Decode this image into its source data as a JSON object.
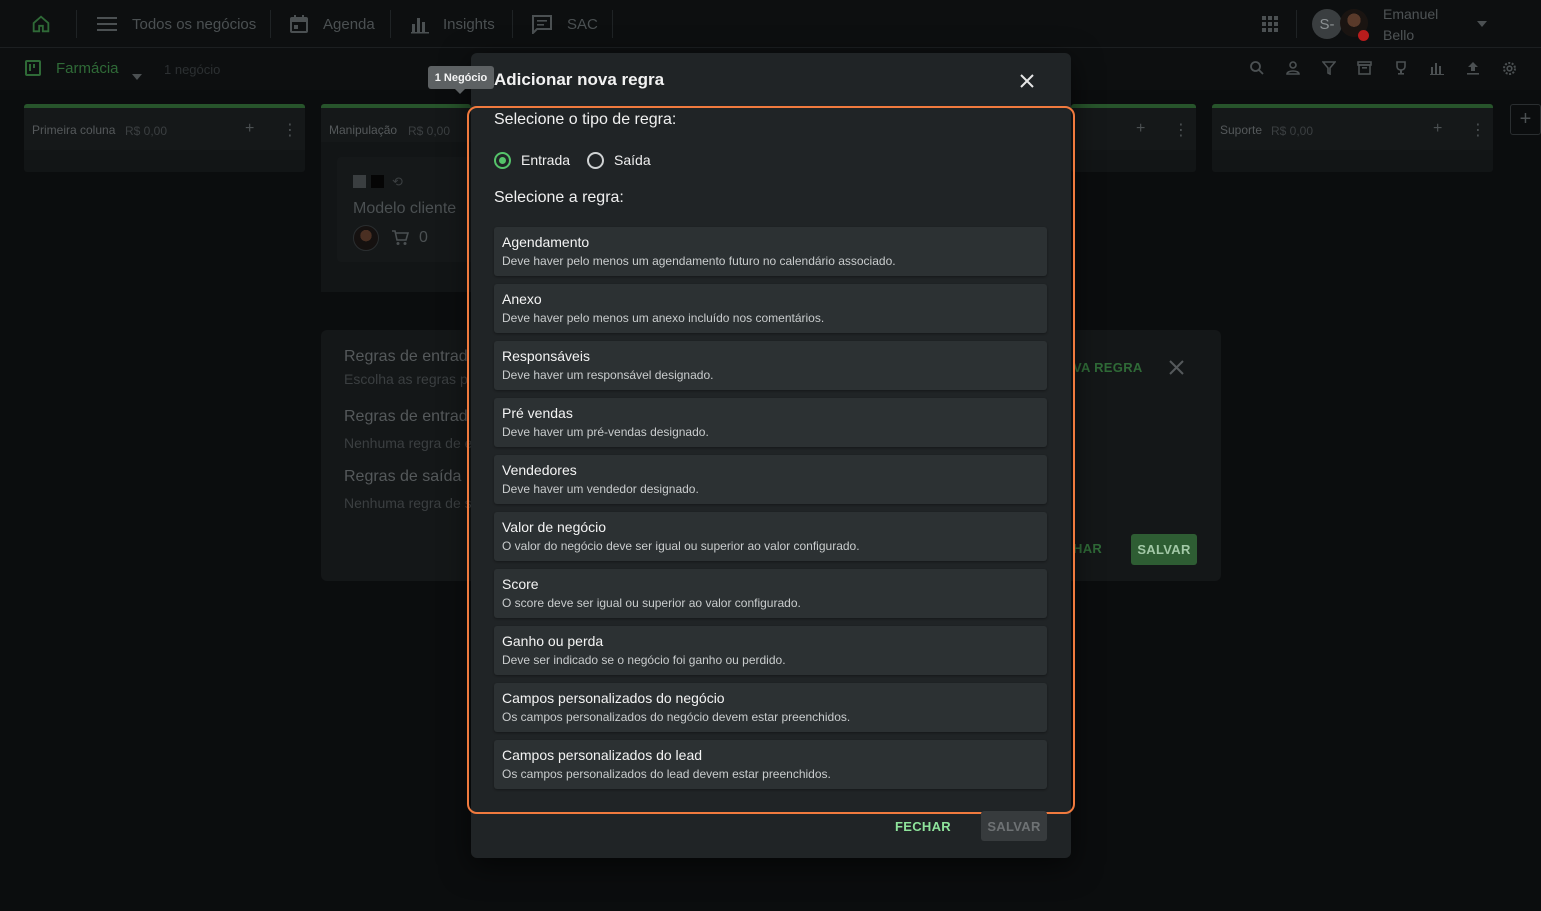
{
  "nav": {
    "items": [
      {
        "label": "Todos os negócios"
      },
      {
        "label": "Agenda"
      },
      {
        "label": "Insights"
      },
      {
        "label": "SAC"
      }
    ],
    "user_initial": "S",
    "user_first_name": "Emanuel",
    "user_last_name": "Bello"
  },
  "pipeline": {
    "name": "Farmácia",
    "deal_count": "1 negócio"
  },
  "columns": [
    {
      "title": "Primeira coluna",
      "amount": "R$ 0,00"
    },
    {
      "title": "Manipulação",
      "amount": "R$ 0,00"
    },
    {
      "title": "Suporte",
      "amount": "R$ 0,00"
    }
  ],
  "card": {
    "title": "Modelo cliente",
    "count": "0"
  },
  "background_panel": {
    "heading_1": "Regras de entrad",
    "sub_1": "Escolha as regras p",
    "heading_2": "Regras de entrad",
    "sub_2": "Nenhuma regra de e",
    "heading_3": "Regras de saída",
    "sub_3": "Nenhuma regra de s",
    "new_rule_fragment": "VA REGRA",
    "close_fragment": "HAR",
    "save_label": "SALVAR"
  },
  "tooltip": "1 Negócio",
  "modal": {
    "title": "Adicionar nova regra",
    "type_label": "Selecione o tipo de regra:",
    "type_options": [
      {
        "label": "Entrada",
        "checked": true
      },
      {
        "label": "Saída",
        "checked": false
      }
    ],
    "rule_label": "Selecione a regra:",
    "rules": [
      {
        "title": "Agendamento",
        "desc": "Deve haver pelo menos um agendamento futuro no calendário associado."
      },
      {
        "title": "Anexo",
        "desc": "Deve haver pelo menos um anexo incluído nos comentários."
      },
      {
        "title": "Responsáveis",
        "desc": "Deve haver um responsável designado."
      },
      {
        "title": "Pré vendas",
        "desc": "Deve haver um pré-vendas designado."
      },
      {
        "title": "Vendedores",
        "desc": "Deve haver um vendedor designado."
      },
      {
        "title": "Valor de negócio",
        "desc": "O valor do negócio deve ser igual ou superior ao valor configurado."
      },
      {
        "title": "Score",
        "desc": "O score deve ser igual ou superior ao valor configurado."
      },
      {
        "title": "Ganho ou perda",
        "desc": "Deve ser indicado se o negócio foi ganho ou perdido."
      },
      {
        "title": "Campos personalizados do negócio",
        "desc": "Os campos personalizados do negócio devem estar preenchidos."
      },
      {
        "title": "Campos personalizados do lead",
        "desc": "Os campos personalizados do lead devem estar preenchidos."
      }
    ],
    "close_label": "FECHAR",
    "save_label": "SALVAR"
  },
  "colors": {
    "accent_green": "#55c36a",
    "highlight_orange": "#f07a3e",
    "modal_bg": "#202426"
  }
}
